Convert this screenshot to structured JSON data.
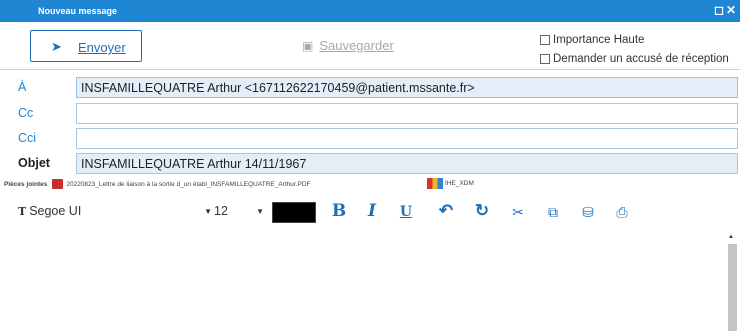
{
  "window": {
    "title": "Nouveau message",
    "controls": "◻✕"
  },
  "actions": {
    "send_label": "Envoyer",
    "save_label": "Sauvegarder"
  },
  "options": {
    "high_importance": "Importance Haute",
    "read_receipt": "Demander un accusé de réception"
  },
  "headers": {
    "to_label": "À",
    "to_value": "INSFAMILLEQUATRE Arthur <167112622170459@patient.mssante.fr>",
    "cc_label": "Cc",
    "cc_value": "",
    "bcc_label": "Cci",
    "bcc_value": "",
    "subject_label": "Objet",
    "subject_value": "INSFAMILLEQUATRE Arthur 14/11/1967"
  },
  "attachments": {
    "label": "Pièces jointes",
    "items": [
      "20220823_Lettre de liaison à la sortie d_un établ_INSFAMILLEQUATRE_Arthur.PDF",
      "IHE_XDM"
    ]
  },
  "formatting": {
    "font_family": "Segoe UI",
    "font_size": "12",
    "text_color": "#000000"
  },
  "colors": {
    "accent": "#1f86d4",
    "button_blue": "#1f6fb8"
  }
}
